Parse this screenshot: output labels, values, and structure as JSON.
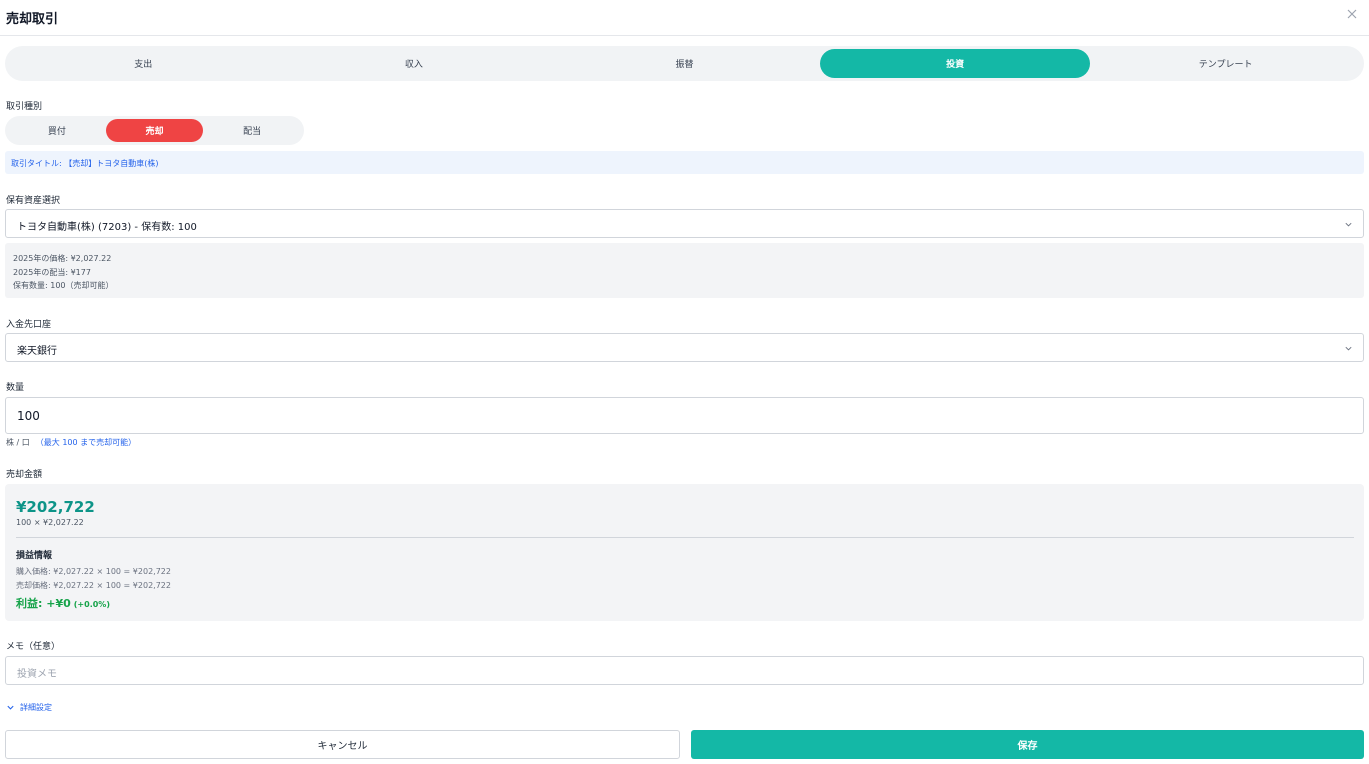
{
  "header": {
    "title": "売却取引"
  },
  "tabs": [
    {
      "label": "支出"
    },
    {
      "label": "収入"
    },
    {
      "label": "振替"
    },
    {
      "label": "投資"
    },
    {
      "label": "テンプレート"
    }
  ],
  "active_tab": "投資",
  "transaction_type": {
    "label": "取引種別",
    "options": [
      {
        "label": "買付"
      },
      {
        "label": "売却"
      },
      {
        "label": "配当"
      }
    ],
    "selected": "売却"
  },
  "title_banner": "取引タイトル: 【売却】トヨタ自動車(株)",
  "asset": {
    "label": "保有資産選択",
    "value": "トヨタ自動車(株) (7203) - 保有数: 100",
    "info": [
      "2025年の価格: ¥2,027.22",
      "2025年の配当: ¥177",
      "保有数量: 100（売却可能）"
    ]
  },
  "deposit_account": {
    "label": "入金先口座",
    "value": "楽天銀行"
  },
  "quantity": {
    "label": "数量",
    "value": "100",
    "unit": "株 / 口",
    "hint": "（最大 100 まで売却可能）"
  },
  "sale_amount": {
    "label": "売却金額",
    "total": "¥202,722",
    "calc": "100 × ¥2,027.22",
    "pl_title": "損益情報",
    "purchase_line": "購入価格: ¥2,027.22 × 100 = ¥202,722",
    "sale_line": "売却価格: ¥2,027.22 × 100 = ¥202,722",
    "profit": "利益: +¥0",
    "profit_pct": "(+0.0%)"
  },
  "memo": {
    "label": "メモ（任意）",
    "placeholder": "投資メモ"
  },
  "advanced": {
    "label": "詳細設定"
  },
  "footer": {
    "cancel_label": "キャンセル",
    "save_label": "保存"
  },
  "colors": {
    "accent": "#14b8a6",
    "sell": "#ef4444",
    "link": "#2563eb",
    "profit": "#16a34a"
  },
  "icons": [
    "close-icon",
    "chevron-down-icon",
    "chevron-down-icon",
    "chevron-down-icon"
  ]
}
